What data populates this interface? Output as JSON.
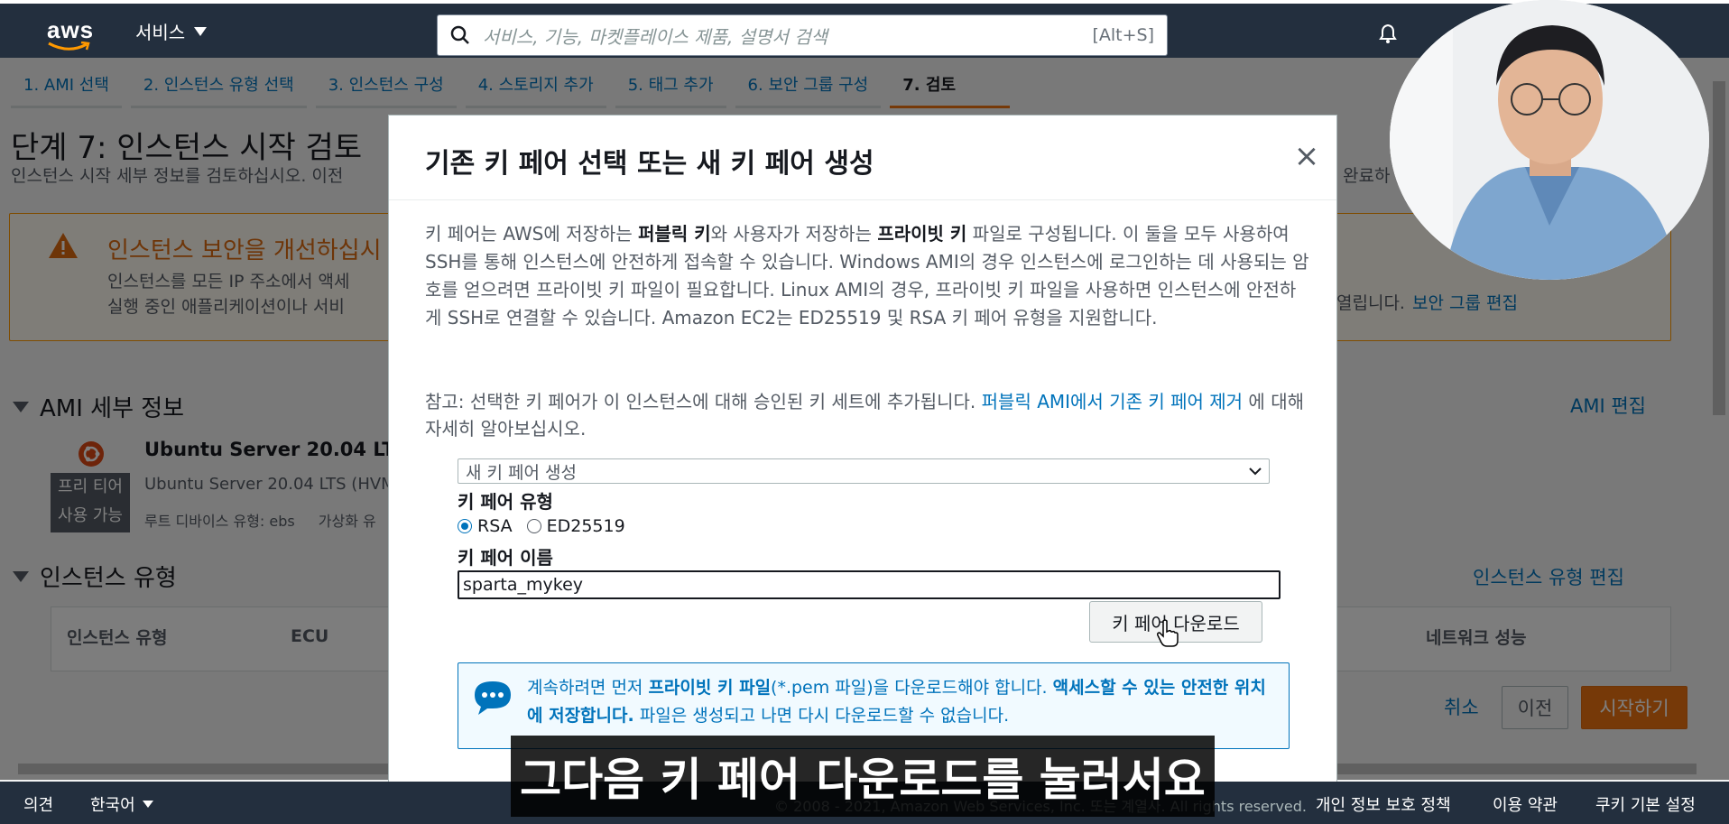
{
  "nav": {
    "logo": "aws",
    "services_label": "서비스",
    "search_placeholder": "서비스, 기능, 마켓플레이스 제품, 설명서 검색",
    "search_shortcut": "[Alt+S]"
  },
  "steps": [
    {
      "label": "1. AMI 선택"
    },
    {
      "label": "2. 인스턴스 유형 선택"
    },
    {
      "label": "3. 인스턴스 구성"
    },
    {
      "label": "4. 스토리지 추가"
    },
    {
      "label": "5. 태그 추가"
    },
    {
      "label": "6. 보안 그룹 구성"
    },
    {
      "label": "7. 검토",
      "active": true
    }
  ],
  "page": {
    "title": "단계 7: 인스턴스 시작 검토",
    "subtitle": "인스턴스 시작 세부 정보를 검토하십시오. 이전",
    "subtitle_right": "완료하",
    "warning_title": "인스턴스 보안을 개선하십시",
    "warning_line1": "인스턴스를 모든 IP 주소에서 액세",
    "warning_line2": "실행 중인 애플리케이션이나 서비",
    "warning_right": "열립니다.",
    "warning_link": "보안 그룹 편집",
    "ami_section": "AMI 세부 정보",
    "ami_edit": "AMI 편집",
    "ami_name": "Ubuntu Server 20.04 LTS",
    "ami_desc": "Ubuntu Server 20.04 LTS (HVM",
    "ami_root": "루트 디바이스 유형: ebs",
    "ami_virt": "가상화 유",
    "free_tier_line1": "프리 티어",
    "free_tier_line2": "사용 가능",
    "instance_section": "인스턴스 유형",
    "instance_edit": "인스턴스 유형 편집",
    "table_headers": [
      "인스턴스 유형",
      "ECU",
      "네트워크 성능"
    ],
    "cancel": "취소",
    "previous": "이전",
    "launch": "시작하기"
  },
  "modal": {
    "title": "기존 키 페어 선택 또는 새 키 페어 생성",
    "close": "×",
    "p1_a": "키 페어는 AWS에 저장하는 ",
    "p1_b": "퍼블릭 키",
    "p1_c": "와 사용자가 저장하는 ",
    "p1_d": "프라이빗 키",
    "p1_e": " 파일로 구성됩니다. 이 둘을 모두 사용하여 SSH를 통해 인스턴스에 안전하게 접속할 수 있습니다. Windows AMI의 경우 인스턴스에 로그인하는 데 사용되는 암호를 얻으려면 프라이빗 키 파일이 필요합니다. Linux AMI의 경우, 프라이빗 키 파일을 사용하면 인스턴스에 안전하게 SSH로 연결할 수 있습니다. Amazon EC2는 ED25519 및 RSA 키 페어 유형을 지원합니다.",
    "p2_a": "참고: 선택한 키 페어가 이 인스턴스에 대해 승인된 키 세트에 추가됩니다. ",
    "p2_link": "퍼블릭 AMI에서 기존 키 페어 제거",
    "p2_b": " 에 대해 자세히 알아보십시오.",
    "select_value": "새 키 페어 생성",
    "key_type_label": "키 페어 유형",
    "radio_rsa": "RSA",
    "radio_ed": "ED25519",
    "key_name_label": "키 페어 이름",
    "key_name_value": "sparta_mykey",
    "download_button": "키 페어 다운로드",
    "info_a": "계속하려면 먼저 ",
    "info_b": "프라이빗 키 파일",
    "info_c": "(*.pem 파일)을 다운로드해야 합니다. ",
    "info_d": "액세스할 수 있는 안전한 위치에 저장합니다.",
    "info_e": " 파일은 생성되고 나면 다시 다운로드할 수 없습니다."
  },
  "footer": {
    "feedback": "의견",
    "language": "한국어",
    "copyright": "© 2008 - 2021, Amazon Web Services, Inc. 또는 계열사. All rights reserved.",
    "privacy": "개인 정보 보호 정책",
    "terms": "이용 약관",
    "cookies": "쿠키 기본 설정"
  },
  "caption": "그다음 키 페어 다운로드를 눌러서요",
  "colors": {
    "nav_bg": "#232f3e",
    "accent_orange": "#ec7211",
    "link_blue": "#0073bb"
  }
}
